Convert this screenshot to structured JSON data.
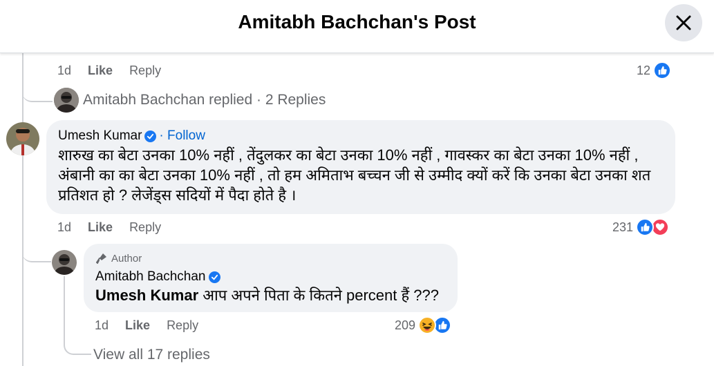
{
  "header": {
    "title": "Amitabh Bachchan's Post"
  },
  "colors": {
    "accent": "#1877f2",
    "love": "#f33e58",
    "haha": "#f7b125",
    "muted": "#65676b",
    "bubble": "#f0f2f5"
  },
  "prev_comment": {
    "time": "1d",
    "like_label": "Like",
    "reply_label": "Reply",
    "reaction_count": "12",
    "reactions": [
      "like-icon"
    ]
  },
  "replied_summary": {
    "text": "Amitabh Bachchan replied · 2 Replies"
  },
  "main_comment": {
    "author": "Umesh Kumar",
    "follow_label": "· Follow",
    "text": "शारुख का बेटा उनका 10% नहीं , तेंदुलकर का बेटा उनका 10% नहीं , गावस्कर का बेटा उनका 10% नहीं , अंबानी का का बेटा उनका 10% नहीं , तो हम अमिताभ बच्चन जी से उम्मीद क्यों करें कि उनका बेटा उनका शत प्रतिशत हो ? लेजेंड्स सदियों में पैदा होते है ।",
    "time": "1d",
    "like_label": "Like",
    "reply_label": "Reply",
    "reaction_count": "231",
    "reactions": [
      "like-icon",
      "love-icon"
    ]
  },
  "reply": {
    "badge": "Author",
    "author": "Amitabh Bachchan",
    "mention": "Umesh Kumar",
    "text": " आप अपने पिता के कितने percent हैं ???",
    "time": "1d",
    "like_label": "Like",
    "reply_label": "Reply",
    "reaction_count": "209",
    "reactions": [
      "haha-icon",
      "like-icon"
    ]
  },
  "view_all": {
    "text": "View all 17 replies"
  }
}
